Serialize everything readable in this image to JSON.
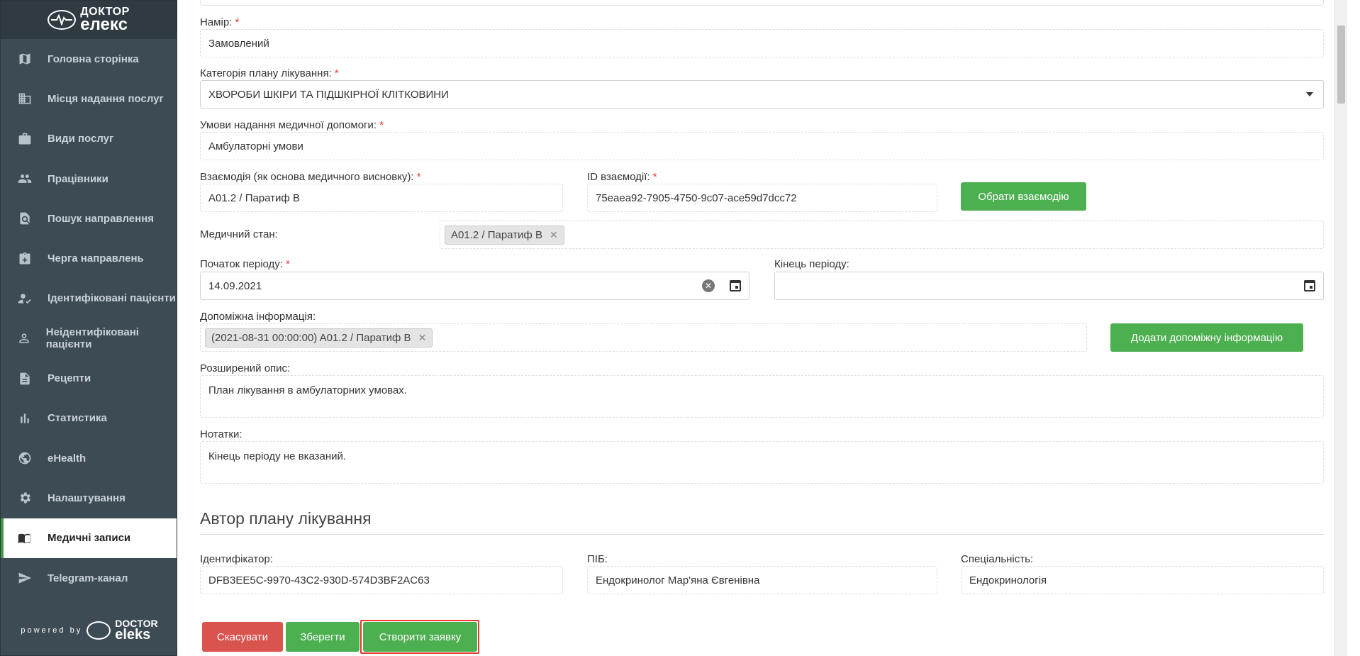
{
  "app": {
    "logo_top_line1": "ДОКТОР",
    "logo_top_line2": "елекс",
    "powered_by": "powered by",
    "powered_brand_line1": "DOCTOR",
    "powered_brand_line2": "eleks"
  },
  "sidebar": {
    "items": [
      {
        "label": "Головна сторінка",
        "icon": "map-icon"
      },
      {
        "label": "Місця надання послуг",
        "icon": "building-icon"
      },
      {
        "label": "Види послуг",
        "icon": "briefcase-icon"
      },
      {
        "label": "Працівники",
        "icon": "people-icon"
      },
      {
        "label": "Пошук направлення",
        "icon": "search-document-icon"
      },
      {
        "label": "Черга направлень",
        "icon": "clipboard-add-icon"
      },
      {
        "label": "Ідентифіковані пацієнти",
        "icon": "person-check-icon"
      },
      {
        "label": "Неідентифіковані пацієнти",
        "icon": "person-outline-icon"
      },
      {
        "label": "Рецепти",
        "icon": "document-icon"
      },
      {
        "label": "Статистика",
        "icon": "bar-chart-icon"
      },
      {
        "label": "eHealth",
        "icon": "globe-icon"
      },
      {
        "label": "Налаштування",
        "icon": "gear-icon"
      },
      {
        "label": "Медичні записи",
        "icon": "book-icon",
        "active": true
      },
      {
        "label": "Telegram-канал",
        "icon": "send-icon"
      }
    ]
  },
  "form": {
    "intent": {
      "label": "Намір:",
      "value": "Замовлений"
    },
    "category": {
      "label": "Категорія плану лікування:",
      "value": "ХВОРОБИ ШКІРИ ТА ПІДШКІРНОЇ КЛІТКОВИНИ"
    },
    "conditions": {
      "label": "Умови надання медичної допомоги:",
      "value": "Амбулаторні умови"
    },
    "encounter": {
      "label": "Взаємодія (як основа медичного висновку):",
      "value": "A01.2 / Паратиф B"
    },
    "encounter_id": {
      "label": "ID взаємодії:",
      "value": "75eaea92-7905-4750-9c07-ace59d7dcc72"
    },
    "choose_encounter_button": "Обрати взаємодію",
    "medical_state": {
      "label": "Медичний стан:",
      "chip": "A01.2 / Паратиф B"
    },
    "period_start": {
      "label": "Початок періоду:",
      "value": "14.09.2021"
    },
    "period_end": {
      "label": "Кінець періоду:",
      "value": ""
    },
    "supporting_info": {
      "label": "Допоміжна інформація:",
      "chip": "(2021-08-31 00:00:00) A01.2 / Паратиф B"
    },
    "add_supporting_button": "Додати допоміжну інформацію",
    "description": {
      "label": "Розширений опис:",
      "value": "План лікування в амбулаторних умовах."
    },
    "notes": {
      "label": "Нотатки:",
      "value": "Кінець періоду не вказаний."
    },
    "required_mark": "*"
  },
  "author": {
    "title": "Автор плану лікування",
    "id": {
      "label": "Ідентифікатор:",
      "value": "DFB3EE5C-9970-43C2-930D-574D3BF2AC63"
    },
    "name": {
      "label": "ПІБ:",
      "value": "Ендокринолог Мар'яна Євгенівна"
    },
    "specialty": {
      "label": "Спеціальність:",
      "value": "Ендокринологія"
    }
  },
  "actions": {
    "cancel": "Скасувати",
    "save": "Зберегти",
    "create": "Створити заявку"
  },
  "colors": {
    "sidebar": "#3d4b54",
    "green": "#4caf50",
    "red": "#d9534f",
    "required": "#e53935"
  }
}
